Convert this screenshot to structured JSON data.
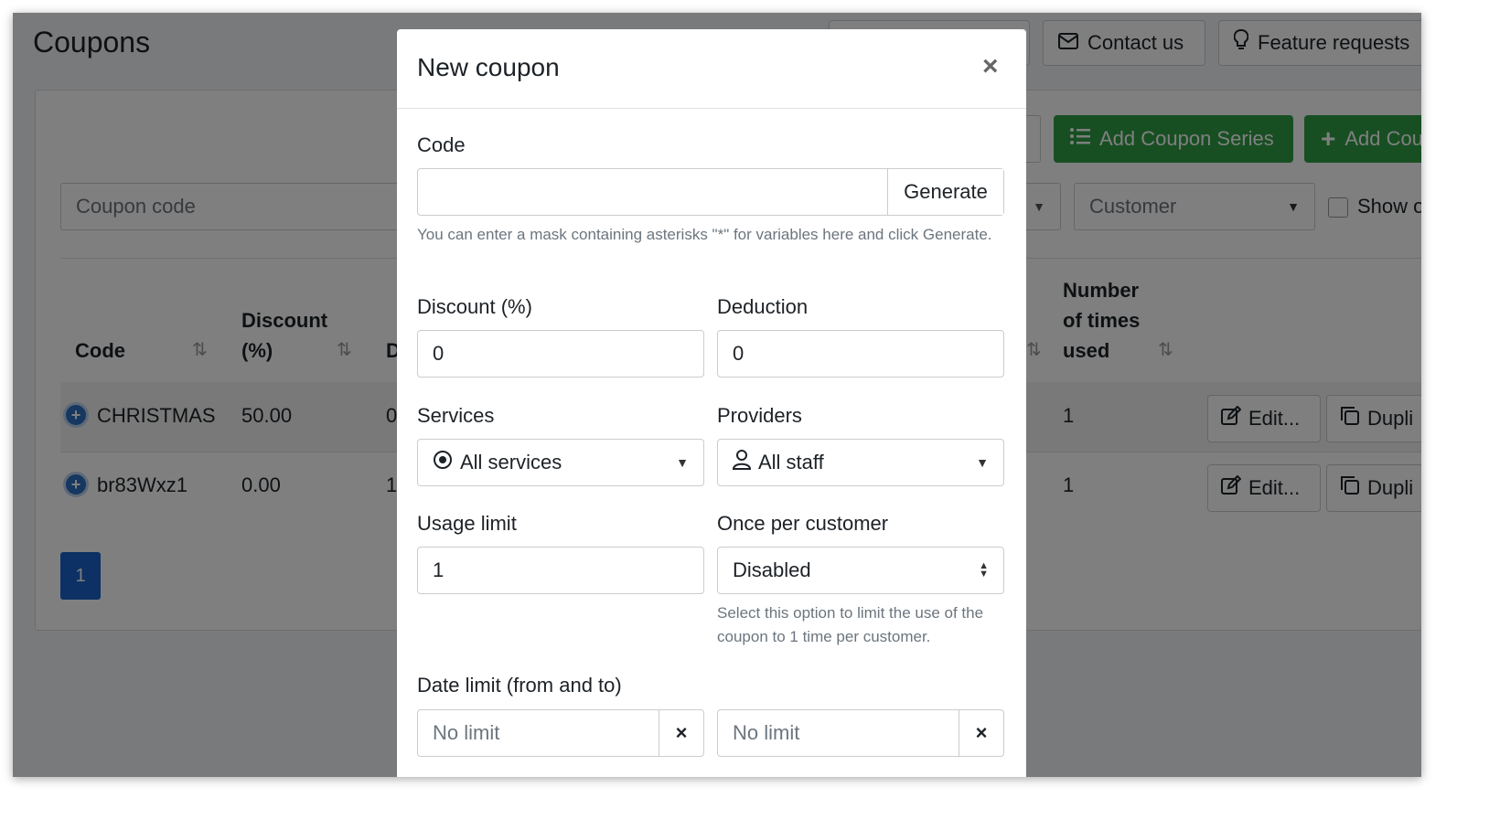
{
  "page": {
    "title": "Coupons",
    "header_buttons": [
      {
        "label": "Contact us",
        "icon": "envelope-icon"
      },
      {
        "label": "Feature requests",
        "icon": "lightbulb-icon"
      }
    ],
    "toolbar": {
      "add_series_label": "Add Coupon Series",
      "add_coupon_label": "Add Cou"
    },
    "filters": {
      "coupon_code_placeholder": "Coupon code",
      "customer_label": "Customer",
      "show_label": "Show o"
    },
    "table": {
      "headers": {
        "code": "Code",
        "discount_line1": "Discount",
        "discount_line2": "(%)",
        "deduction_partial": "D",
        "times_used_line1": "Number",
        "times_used_line2": "of times",
        "times_used_line3": "used"
      },
      "sort_glyph": "⇅",
      "rows": [
        {
          "code": "CHRISTMAS",
          "discount": "50.00",
          "deduction_partial": "0",
          "times_used": "1",
          "edit_label": "Edit...",
          "duplicate_label": "Dupli"
        },
        {
          "code": "br83Wxz1",
          "discount": "0.00",
          "deduction_partial": "1",
          "times_used": "1",
          "edit_label": "Edit...",
          "duplicate_label": "Dupli"
        }
      ]
    },
    "pagination": {
      "current": "1"
    }
  },
  "modal": {
    "title": "New coupon",
    "close_glyph": "×",
    "code": {
      "label": "Code",
      "value": "",
      "generate_label": "Generate",
      "help": "You can enter a mask containing asterisks \"*\" for variables here and click Generate."
    },
    "discount": {
      "label": "Discount (%)",
      "value": "0"
    },
    "deduction": {
      "label": "Deduction",
      "value": "0"
    },
    "services": {
      "label": "Services",
      "value": "All services"
    },
    "providers": {
      "label": "Providers",
      "value": "All staff"
    },
    "usage_limit": {
      "label": "Usage limit",
      "value": "1"
    },
    "once_per_customer": {
      "label": "Once per customer",
      "value": "Disabled",
      "help": "Select this option to limit the use of the coupon to 1 time per customer."
    },
    "date_limit": {
      "label": "Date limit (from and to)",
      "from_value": "No limit",
      "to_value": "No limit",
      "clear_glyph": "×"
    }
  },
  "colors": {
    "primary_green": "#2e9e44",
    "primary_blue": "#1a63c9",
    "backdrop": "rgba(0,0,0,0.5)"
  }
}
